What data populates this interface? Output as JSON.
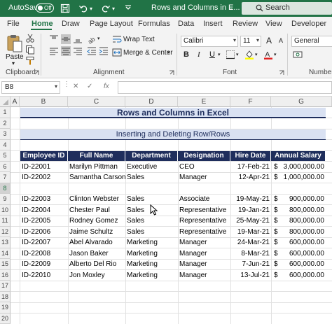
{
  "titlebar": {
    "autosave_label": "AutoSave",
    "toggle_state": "Off",
    "doc_title": "Rows and Columns in E...",
    "search_placeholder": "Search"
  },
  "tabs": [
    "File",
    "Home",
    "Draw",
    "Page Layout",
    "Formulas",
    "Data",
    "Insert",
    "Review",
    "View",
    "Developer"
  ],
  "active_tab": "Home",
  "ribbon": {
    "clipboard": {
      "paste_label": "Paste",
      "group_label": "Clipboard"
    },
    "alignment": {
      "wrap_text": "Wrap Text",
      "merge_center": "Merge & Center",
      "group_label": "Alignment"
    },
    "font": {
      "font_name": "Calibri",
      "font_size": "11",
      "group_label": "Font",
      "bold": "B",
      "italic": "I",
      "underline": "U",
      "grow": "A",
      "shrink": "A"
    },
    "number": {
      "format": "General",
      "group_label": "Number"
    }
  },
  "formula_bar": {
    "name_box": "B8",
    "fx_label": "fx",
    "cancel": "✕",
    "confirm": "✓"
  },
  "columns": [
    "A",
    "B",
    "C",
    "D",
    "E",
    "F",
    "G"
  ],
  "rows": [
    "1",
    "2",
    "3",
    "4",
    "5",
    "6",
    "7",
    "8",
    "9",
    "10",
    "11",
    "12",
    "13",
    "14",
    "15",
    "16",
    "17",
    "18",
    "19",
    "20"
  ],
  "sheet": {
    "title": "Rows and Columns in Excel",
    "subtitle": "Inserting and Deleting Row/Rows",
    "headers": [
      "Employee ID",
      "Full Name",
      "Department",
      "Designation",
      "Hire Date",
      "Annual Salary"
    ],
    "data": [
      {
        "row": "6",
        "id": "ID-22001",
        "name": "Marilyn Pittman",
        "dept": "Executive",
        "desig": "CEO",
        "date": "17-Feb-21",
        "cur": "$",
        "salary": "3,000,000.00"
      },
      {
        "row": "7",
        "id": "ID-22002",
        "name": "Samantha Carson",
        "dept": "Sales",
        "desig": "Manager",
        "date": "12-Apr-21",
        "cur": "$",
        "salary": "1,000,000.00"
      },
      {
        "row": "9",
        "id": "ID-22003",
        "name": "Clinton Webster",
        "dept": "Sales",
        "desig": "Associate",
        "date": "19-May-21",
        "cur": "$",
        "salary": "900,000.00"
      },
      {
        "row": "10",
        "id": "ID-22004",
        "name": "Chester Paul",
        "dept": "Sales",
        "desig": "Representative",
        "date": "19-Jan-21",
        "cur": "$",
        "salary": "800,000.00"
      },
      {
        "row": "11",
        "id": "ID-22005",
        "name": "Rodney Gomez",
        "dept": "Sales",
        "desig": "Representative",
        "date": "25-May-21",
        "cur": "$",
        "salary": "800,000.00"
      },
      {
        "row": "12",
        "id": "ID-22006",
        "name": "Jaime Schultz",
        "dept": "Sales",
        "desig": "Representative",
        "date": "19-Mar-21",
        "cur": "$",
        "salary": "800,000.00"
      },
      {
        "row": "13",
        "id": "ID-22007",
        "name": "Abel Alvarado",
        "dept": "Marketing",
        "desig": "Manager",
        "date": "24-Mar-21",
        "cur": "$",
        "salary": "600,000.00"
      },
      {
        "row": "14",
        "id": "ID-22008",
        "name": "Jason Baker",
        "dept": "Marketing",
        "desig": "Manager",
        "date": "8-Mar-21",
        "cur": "$",
        "salary": "600,000.00"
      },
      {
        "row": "15",
        "id": "ID-22009",
        "name": "Alberto Del Rio",
        "dept": "Marketing",
        "desig": "Manager",
        "date": "7-Jun-21",
        "cur": "$",
        "salary": "600,000.00"
      },
      {
        "row": "16",
        "id": "ID-22010",
        "name": "Jon Moxley",
        "dept": "Marketing",
        "desig": "Manager",
        "date": "13-Jul-21",
        "cur": "$",
        "salary": "600,000.00"
      }
    ]
  },
  "colors": {
    "excel_green": "#217346",
    "header_navy": "#1f2e5c",
    "band_blue": "#d9e1f2"
  }
}
